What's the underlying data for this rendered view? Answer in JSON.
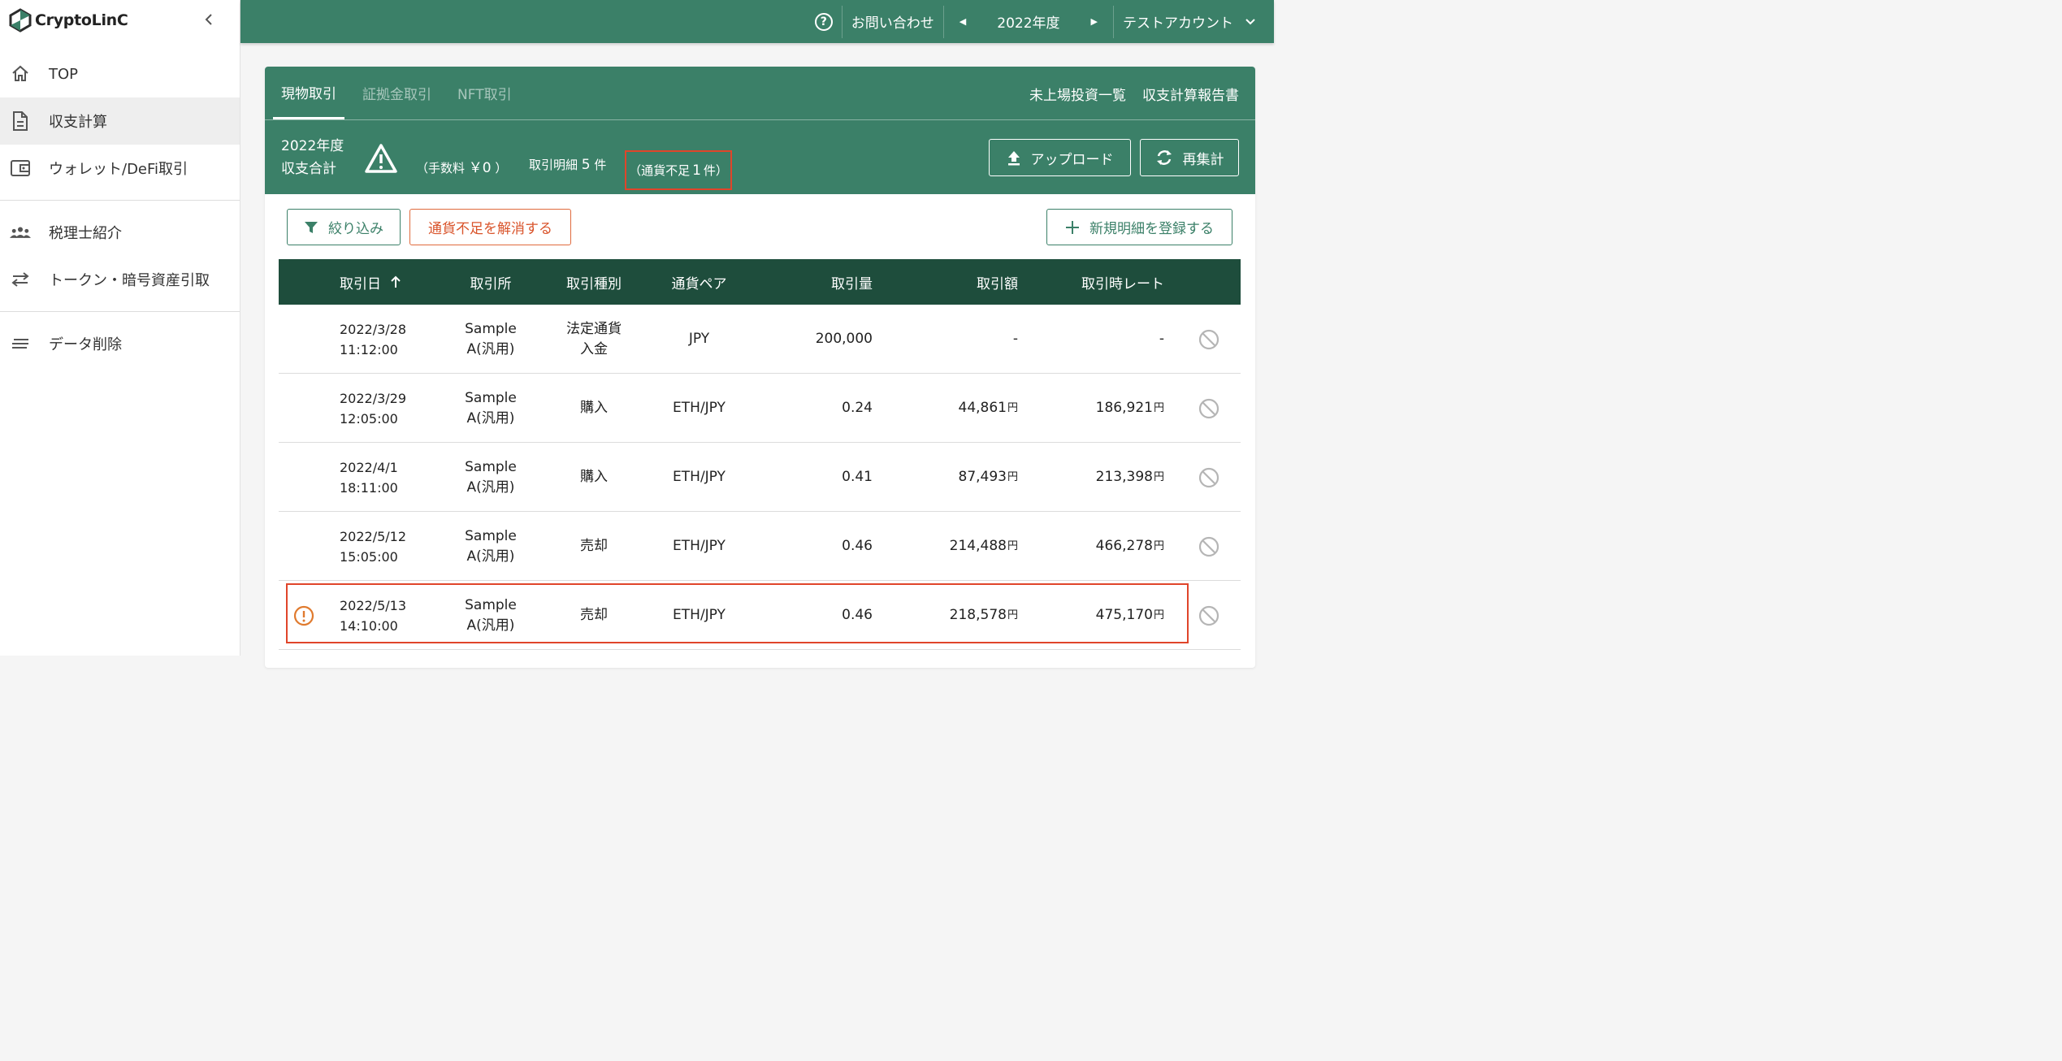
{
  "brand": {
    "name": "CryptoLinC"
  },
  "sidebar": {
    "items": [
      {
        "label": "TOP",
        "icon": "home-icon"
      },
      {
        "label": "収支計算",
        "icon": "document-icon",
        "active": true
      },
      {
        "label": "ウォレット/DeFi取引",
        "icon": "wallet-icon"
      },
      {
        "label": "税理士紹介",
        "icon": "people-icon"
      },
      {
        "label": "トークン・暗号資産引取",
        "icon": "swap-arrows-icon"
      },
      {
        "label": "データ削除",
        "icon": "lines-icon"
      }
    ]
  },
  "topbar": {
    "contact": "お問い合わせ",
    "year": "2022年度",
    "account": "テストアカウント"
  },
  "tabs": {
    "items": [
      "現物取引",
      "証拠金取引",
      "NFT取引"
    ],
    "right_links": [
      "未上場投資一覧",
      "収支計算報告書"
    ]
  },
  "summary": {
    "year": "2022年度",
    "title": "収支合計",
    "fee_prefix": "（手数料",
    "fee_value": "￥0",
    "fee_suffix": "）",
    "count_label": "取引明細",
    "count_value": "5",
    "count_unit": "件",
    "shortage_label": "（通貨不足",
    "shortage_value": "1",
    "shortage_unit": "件）",
    "upload_label": "アップロード",
    "recalc_label": "再集計"
  },
  "actions": {
    "filter_label": "絞り込み",
    "resolve_label": "通貨不足を解消する",
    "new_label": "新規明細を登録する"
  },
  "table": {
    "headers": {
      "date": "取引日",
      "exchange": "取引所",
      "type": "取引種別",
      "pair": "通貨ペア",
      "amount": "取引量",
      "value": "取引額",
      "rate": "取引時レート"
    },
    "yen_unit": "円",
    "rows": [
      {
        "date": "2022/3/28",
        "time": "11:12:00",
        "ex1": "Sample",
        "ex2": "A(汎用)",
        "type1": "法定通貨",
        "type2": "入金",
        "pair": "JPY",
        "amount": "200,000",
        "value": "-",
        "rate": "-",
        "alert": false
      },
      {
        "date": "2022/3/29",
        "time": "12:05:00",
        "ex1": "Sample",
        "ex2": "A(汎用)",
        "type1": "購入",
        "type2": "",
        "pair": "ETH/JPY",
        "amount": "0.24",
        "value": "44,861",
        "rate": "186,921",
        "alert": false
      },
      {
        "date": "2022/4/1",
        "time": "18:11:00",
        "ex1": "Sample",
        "ex2": "A(汎用)",
        "type1": "購入",
        "type2": "",
        "pair": "ETH/JPY",
        "amount": "0.41",
        "value": "87,493",
        "rate": "213,398",
        "alert": false
      },
      {
        "date": "2022/5/12",
        "time": "15:05:00",
        "ex1": "Sample",
        "ex2": "A(汎用)",
        "type1": "売却",
        "type2": "",
        "pair": "ETH/JPY",
        "amount": "0.46",
        "value": "214,488",
        "rate": "466,278",
        "alert": false
      },
      {
        "date": "2022/5/13",
        "time": "14:10:00",
        "ex1": "Sample",
        "ex2": "A(汎用)",
        "type1": "売却",
        "type2": "",
        "pair": "ETH/JPY",
        "amount": "0.46",
        "value": "218,578",
        "rate": "475,170",
        "alert": true
      }
    ]
  },
  "colors": {
    "primary": "#3b8068",
    "header_dark": "#1e4d3c",
    "alert": "#e0452a"
  }
}
